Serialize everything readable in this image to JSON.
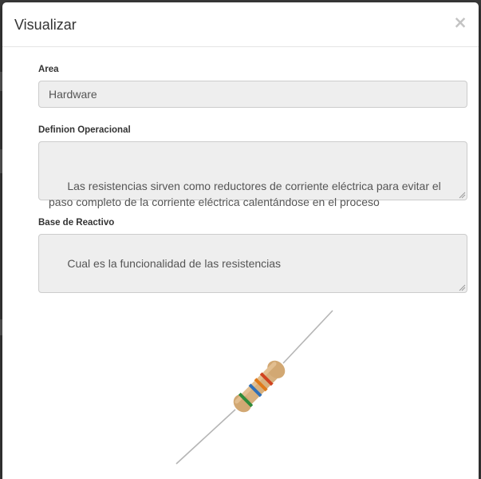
{
  "modal": {
    "title": "Visualizar",
    "close_label": "×"
  },
  "form": {
    "area": {
      "label": "Area",
      "value": "Hardware"
    },
    "definition": {
      "label": "Definion Operacional",
      "value": "Las resistencias sirven como reductores de corriente eléctrica para evitar el paso completo de la corriente eléctrica calentándose en el proceso"
    },
    "base": {
      "label": "Base de Reactivo",
      "value": "Cual es la funcionalidad de las resistencias"
    }
  },
  "image": {
    "subject": "resistor",
    "colors": {
      "body": "#d9b98a",
      "lead": "#b8b8b8",
      "band_red": "#d0421f",
      "band_orange": "#e07a1a",
      "band_blue": "#2f6fb8",
      "band_green": "#2e8b3a"
    }
  }
}
